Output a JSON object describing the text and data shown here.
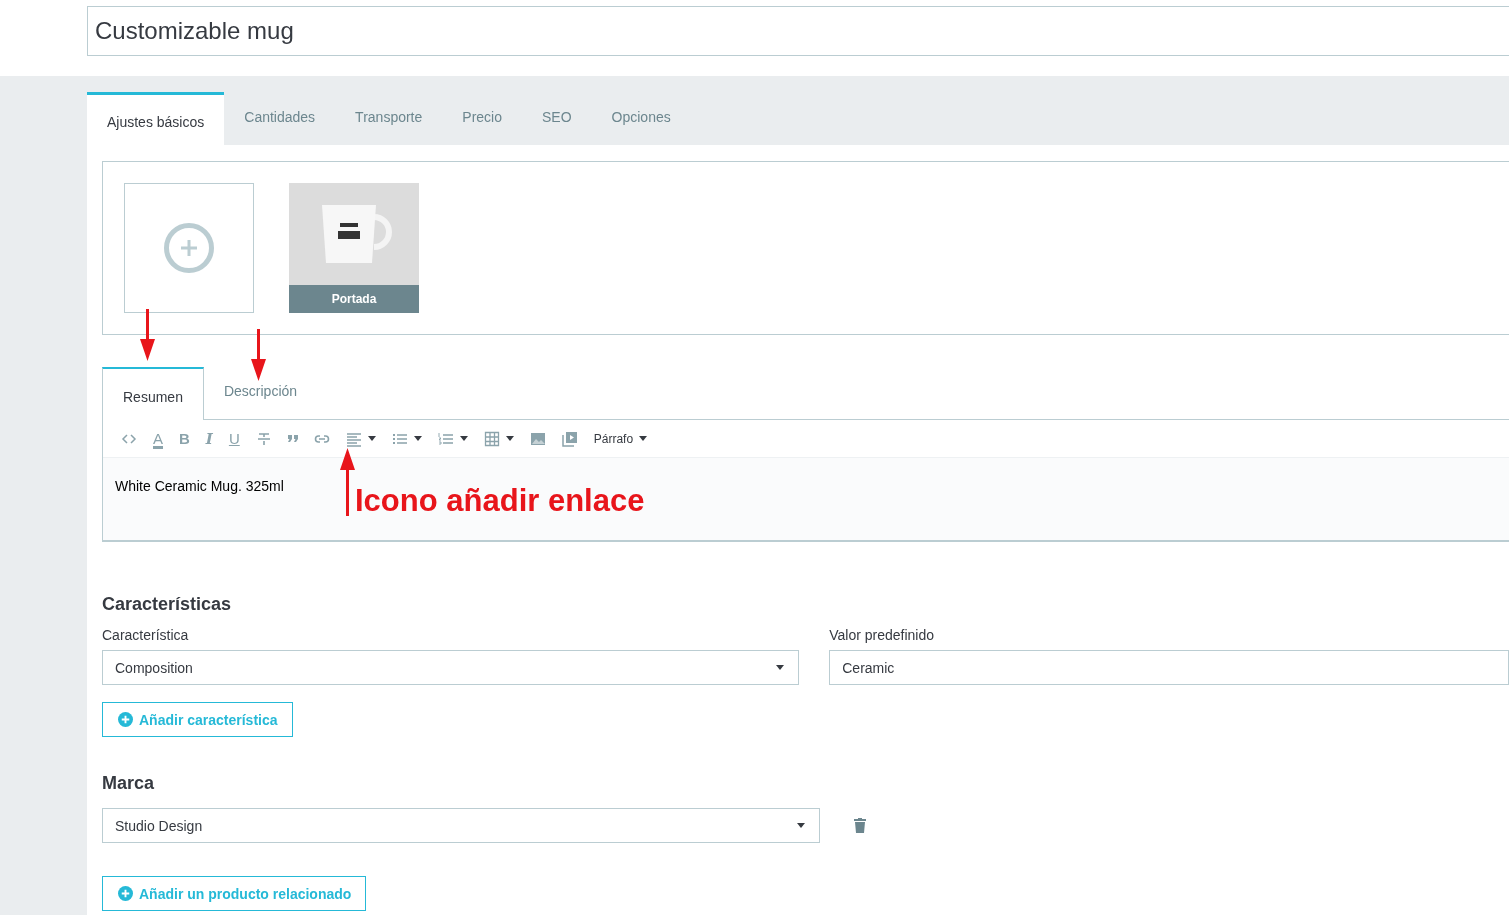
{
  "title_field": {
    "value": "Customizable mug"
  },
  "tabs": [
    {
      "label": "Ajustes básicos",
      "selected": true
    },
    {
      "label": "Cantidades",
      "selected": false
    },
    {
      "label": "Transporte",
      "selected": false
    },
    {
      "label": "Precio",
      "selected": false
    },
    {
      "label": "SEO",
      "selected": false
    },
    {
      "label": "Opciones",
      "selected": false
    }
  ],
  "images": [
    {
      "kind": "add"
    },
    {
      "kind": "photo",
      "caption": "Portada"
    }
  ],
  "editor_tabs": [
    {
      "label": "Resumen",
      "selected": true
    },
    {
      "label": "Descripción",
      "selected": false
    }
  ],
  "toolbar": [
    {
      "kind": "code"
    },
    {
      "kind": "text-color",
      "glyph": "A"
    },
    {
      "kind": "bold",
      "glyph": "B"
    },
    {
      "kind": "italic",
      "glyph": "I"
    },
    {
      "kind": "underline",
      "glyph": "U"
    },
    {
      "kind": "strike"
    },
    {
      "kind": "quote"
    },
    {
      "kind": "link"
    },
    {
      "kind": "align",
      "dropdown": true
    },
    {
      "kind": "bullets",
      "dropdown": true
    },
    {
      "kind": "numbers",
      "dropdown": true
    },
    {
      "kind": "table",
      "dropdown": true
    },
    {
      "kind": "image"
    },
    {
      "kind": "media"
    },
    {
      "kind": "format",
      "label": "Párrafo",
      "dropdown": true
    }
  ],
  "editor_text": "White Ceramic Mug. 325ml",
  "annotation": {
    "label": "Icono añadir enlace",
    "arrows": [
      {
        "kind": "down"
      },
      {
        "kind": "down"
      },
      {
        "kind": "up"
      }
    ]
  },
  "features": {
    "heading": "Características",
    "feature_label": "Característica",
    "feature_value": "Composition",
    "value_label": "Valor predefinido",
    "value_value": "Ceramic",
    "add_button": "Añadir característica"
  },
  "brand": {
    "heading": "Marca",
    "value": "Studio Design",
    "add_related_button": "Añadir un producto relacionado"
  }
}
